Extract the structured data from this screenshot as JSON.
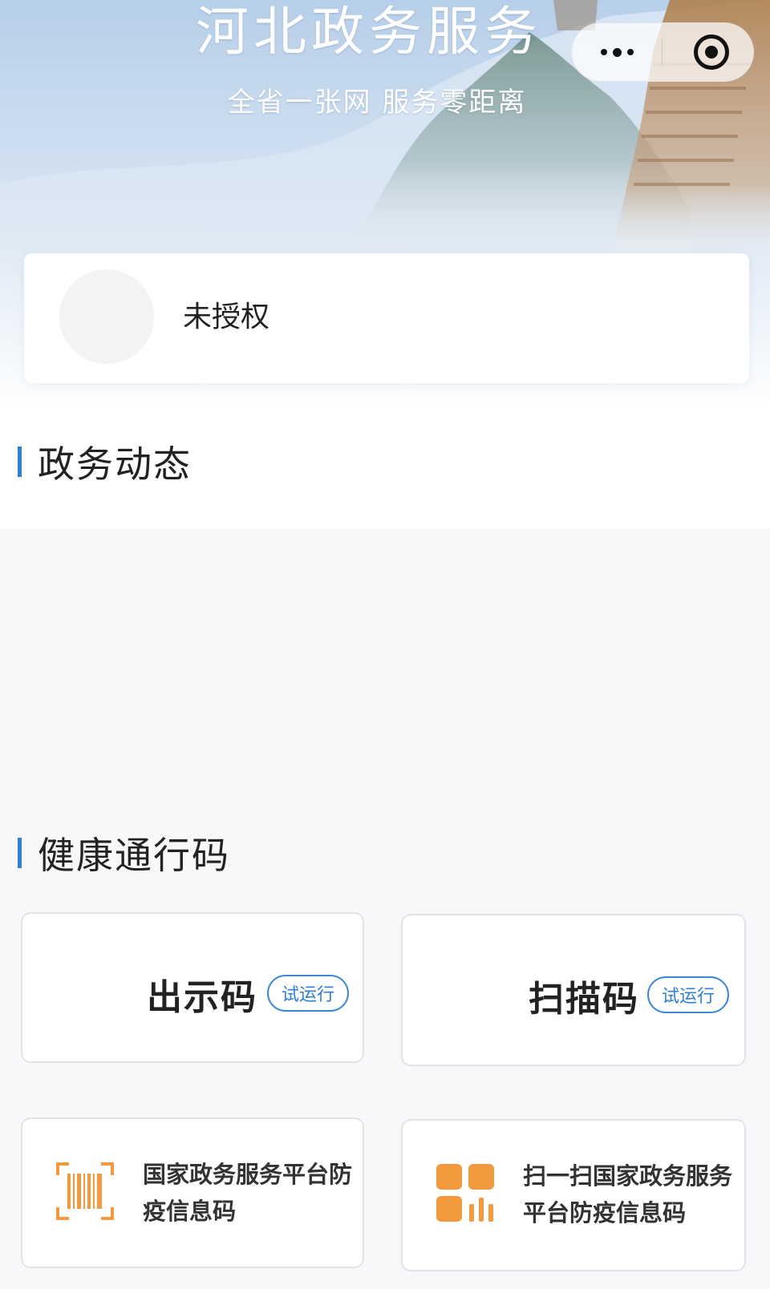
{
  "header": {
    "title": "河北政务服务",
    "subtitle": "全省一张网 服务零距离"
  },
  "capsule": {
    "more_icon": "more-dots-icon",
    "close_icon": "target-close-icon"
  },
  "user": {
    "name": "未授权"
  },
  "sections": {
    "news_title": "政务动态",
    "health_title": "健康通行码"
  },
  "health_codes": {
    "show_code": {
      "label": "出示码",
      "badge": "试运行"
    },
    "scan_code": {
      "label": "扫描码",
      "badge": "试运行"
    },
    "national_code": {
      "label": "国家政务服务平台防疫信息码",
      "icon": "barcode-icon"
    },
    "scan_national_code": {
      "label": "扫一扫国家政务服务平台防疫信息码",
      "icon": "qr-grid-icon"
    }
  },
  "colors": {
    "accent": "#2f7fd6",
    "orange": "#f29a3d"
  }
}
